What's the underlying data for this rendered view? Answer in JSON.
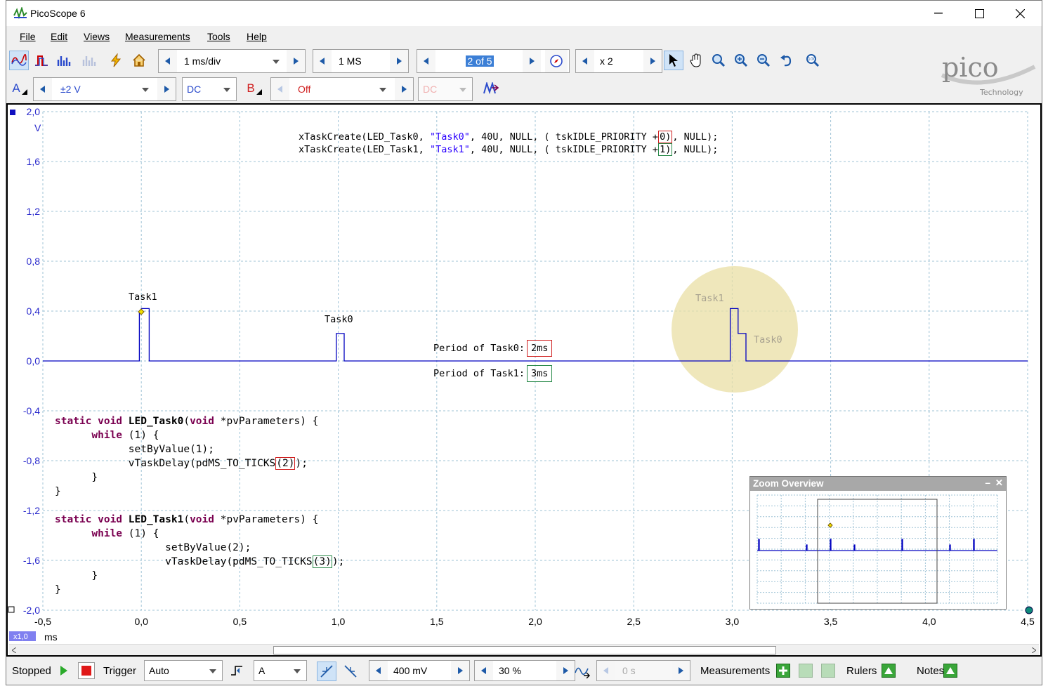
{
  "window": {
    "title": "PicoScope 6"
  },
  "menu": [
    "File",
    "Edit",
    "Views",
    "Measurements",
    "Tools",
    "Help"
  ],
  "toolbar1": {
    "timebase": "1 ms/div",
    "samples": "1 MS",
    "buffer": "2 of 5",
    "zoom": "x 2"
  },
  "toolbar2": {
    "channel_a": "A",
    "range_a": "±2 V",
    "coupling_a": "DC",
    "channel_b": "B",
    "range_b": "Off",
    "coupling_b": "DC"
  },
  "logo": {
    "brand": "pico",
    "sub": "Technology"
  },
  "plot": {
    "y_unit": "V",
    "x_unit": "ms",
    "x_zoom": "x1,0",
    "y_ticks": [
      "2,0",
      "1,6",
      "1,2",
      "0,8",
      "0,4",
      "0,0",
      "-0,4",
      "-0,8",
      "-1,2",
      "-1,6",
      "-2,0"
    ],
    "x_ticks": [
      "-0,5",
      "0,0",
      "0,5",
      "1,0",
      "1,5",
      "2,0",
      "2,5",
      "3,0",
      "3,5",
      "4,0",
      "4,5"
    ],
    "labels": {
      "task1": "Task1",
      "task0": "Task0",
      "task1_faded": "Task1",
      "task0_faded": "Task0",
      "period0_label": "Period of Task0:",
      "period0_value": "2ms",
      "period1_label": "Period of Task1:",
      "period1_value": "3ms"
    },
    "code_top": {
      "l1a": "xTaskCreate(LED_Task0, ",
      "l1s": "\"Task0\"",
      "l1b": ", 40U, NULL, ( tskIDLE_PRIORITY +",
      "l1p": "0)",
      "l1c": ", NULL);",
      "l2a": "xTaskCreate(LED_Task1, ",
      "l2s": "\"Task1\"",
      "l2b": ", 40U, NULL, ( tskIDLE_PRIORITY +",
      "l2p": "1)",
      "l2c": ", NULL);"
    },
    "code_task0": {
      "kw1": "static void ",
      "fn": "LED_Task0",
      "rest": "(",
      "kw2": "void",
      "rest2": " *pvParameters) {",
      "while_kw": "while",
      "while_rest": " (1) {",
      "l3": "setByValue(1);",
      "l4a": "vTaskDelay(pdMS_TO_TICKS",
      "l4b": "(2)",
      "l4c": ");",
      "close1": "}",
      "close2": "}"
    },
    "code_task1": {
      "kw1": "static void ",
      "fn": "LED_Task1",
      "rest": "(",
      "kw2": "void",
      "rest2": " *pvParameters) {",
      "while_kw": "while",
      "while_rest": " (1) {",
      "l3": "setByValue(2);",
      "l4a": "vTaskDelay(pdMS_TO_TICKS",
      "l4b": "(3)",
      "l4c": ");",
      "close1": "}",
      "close2": "}"
    },
    "zoom_overview": {
      "title": "Zoom Overview",
      "min": "–",
      "close": "✕"
    }
  },
  "chart_data": {
    "type": "line",
    "xlabel": "ms",
    "ylabel": "V",
    "xlim": [
      -0.5,
      4.5
    ],
    "ylim": [
      -2.0,
      2.0
    ],
    "grid": true,
    "series": [
      {
        "color": "#0000c0",
        "x": [
          -0.5,
          -0.01,
          -0.01,
          0.0,
          0.0,
          0.04,
          0.04,
          0.99,
          0.99,
          1.03,
          1.03,
          2.99,
          2.99,
          3.03,
          3.03,
          3.07,
          3.07,
          4.5
        ],
        "y": [
          0.0,
          0.0,
          0.4,
          0.4,
          0.42,
          0.42,
          0.0,
          0.0,
          0.22,
          0.22,
          0.0,
          0.0,
          0.42,
          0.42,
          0.22,
          0.22,
          0.0,
          0.0
        ]
      }
    ]
  },
  "statusbar": {
    "state": "Stopped",
    "trigger_label": "Trigger",
    "trigger_mode": "Auto",
    "trigger_channel": "A",
    "threshold": "400 mV",
    "pretrigger": "30 %",
    "delay": "0 s",
    "measurements": "Measurements",
    "rulers": "Rulers",
    "notes": "Notes"
  },
  "colors": {
    "trace": "#0000c0",
    "axis_text": "#2a2acc",
    "grid": "#9fc3d6",
    "highlight": "#e9dfa4"
  }
}
